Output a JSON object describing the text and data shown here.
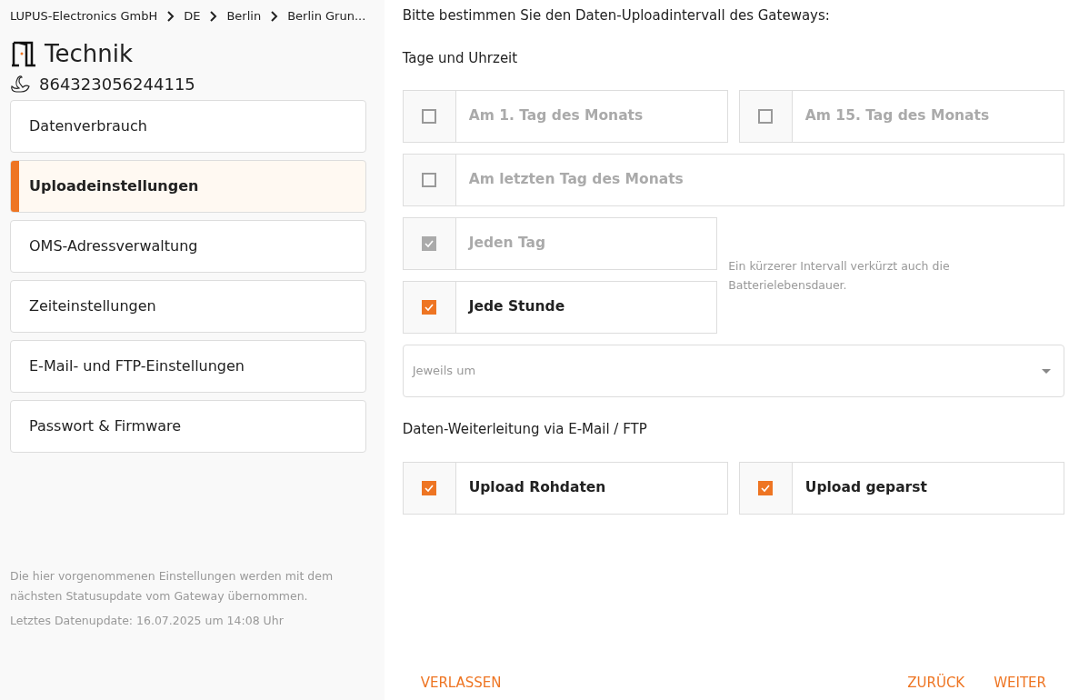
{
  "breadcrumb": [
    "LUPUS-Electronics GmbH",
    "DE",
    "Berlin",
    "Berlin Grun..."
  ],
  "device": {
    "title": "Technik",
    "serial": "864323056244115"
  },
  "nav": [
    {
      "label": "Datenverbrauch",
      "selected": false
    },
    {
      "label": "Uploadeinstellungen",
      "selected": true
    },
    {
      "label": "OMS-Adressverwaltung",
      "selected": false
    },
    {
      "label": "Zeiteinstellungen",
      "selected": false
    },
    {
      "label": "E-Mail- und FTP-Einstellungen",
      "selected": false
    },
    {
      "label": "Passwort & Firmware",
      "selected": false
    }
  ],
  "sidebar_note": "Die hier vorgenommenen Einstellungen werden mit dem nächsten Statusupdate vom Gateway übernommen.",
  "last_update": "Letztes Datenupdate: 16.07.2025 um 14:08 Uhr",
  "intro": "Bitte bestimmen Sie den Daten-Uploadintervall des Gateways:",
  "interval_heading": "Tage und Uhrzeit",
  "interval_rows": [
    {
      "options": [
        {
          "label": "Am 1. Tag des Monats",
          "checked": false,
          "disabled": true
        },
        {
          "label": "Am 15. Tag des Monats",
          "checked": false,
          "disabled": true
        }
      ]
    },
    {
      "options": [
        {
          "label": "Am letzten Tag des Monats",
          "checked": false,
          "disabled": true
        }
      ]
    },
    {
      "options": [
        {
          "label": "Jeden Tag",
          "checked": true,
          "disabled": true
        },
        {
          "label": "Jede Stunde",
          "checked": true,
          "disabled": false
        }
      ],
      "note": "Ein kürzerer Intervall verkürzt auch die Batterielebensdauer."
    }
  ],
  "time_select": {
    "placeholder": "Jeweils um"
  },
  "forward_heading": "Daten-Weiterleitung via E-Mail / FTP",
  "forward_options": [
    {
      "label": "Upload Rohdaten",
      "checked": true,
      "disabled": false
    },
    {
      "label": "Upload geparst",
      "checked": true,
      "disabled": false
    }
  ],
  "footer": {
    "left": "VERLASSEN",
    "right": [
      "ZURÜCK",
      "WEITER"
    ]
  }
}
